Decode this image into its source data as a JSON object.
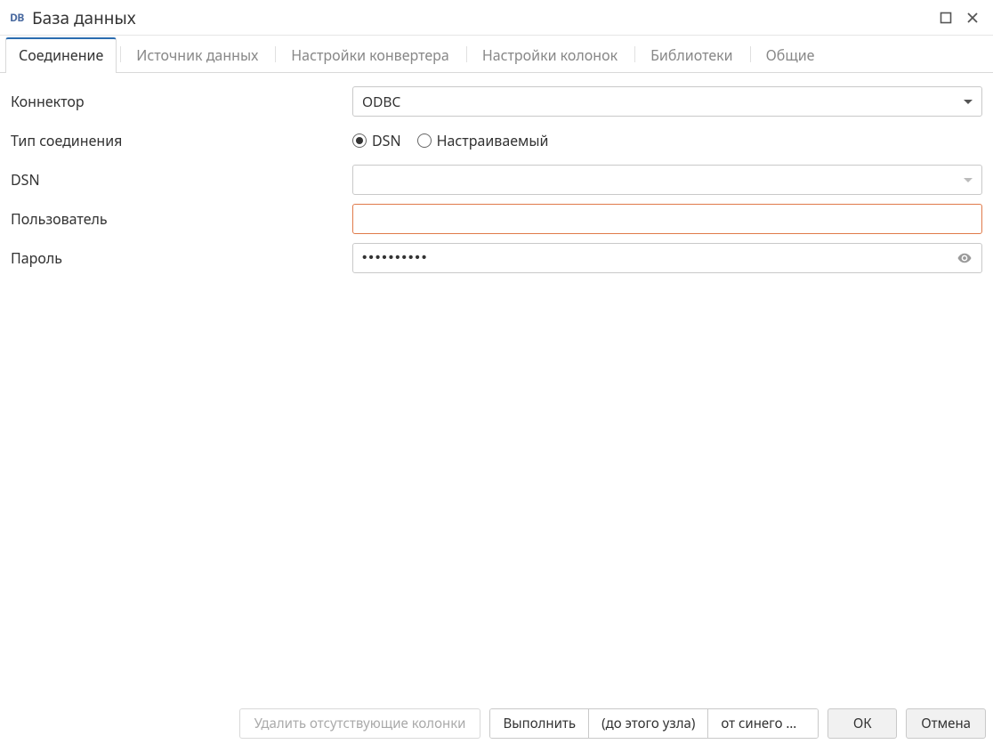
{
  "header": {
    "logo_text": "DB",
    "title": "База данных"
  },
  "tabs": [
    {
      "id": "connection",
      "label": "Соединение",
      "active": true
    },
    {
      "id": "datasource",
      "label": "Источник данных",
      "active": false
    },
    {
      "id": "converter",
      "label": "Настройки конвертера",
      "active": false
    },
    {
      "id": "columns",
      "label": "Настройки колонок",
      "active": false
    },
    {
      "id": "libraries",
      "label": "Библиотеки",
      "active": false
    },
    {
      "id": "general",
      "label": "Общие",
      "active": false
    }
  ],
  "form": {
    "connector_label": "Коннектор",
    "connector_value": "ODBC",
    "conn_type_label": "Тип соединения",
    "conn_type_options": {
      "dsn": {
        "label": "DSN",
        "selected": true
      },
      "custom": {
        "label": "Настраиваемый",
        "selected": false
      }
    },
    "dsn_label": "DSN",
    "dsn_value": "",
    "user_label": "Пользователь",
    "user_value": "",
    "password_label": "Пароль",
    "password_value": "••••••••••"
  },
  "footer": {
    "delete_missing": "Удалить отсутствующие колонки",
    "execute": "Выполнить",
    "upto_node": "(до этого узла)",
    "from_blue": "от синего …",
    "ok": "ОК",
    "cancel": "Отмена"
  }
}
